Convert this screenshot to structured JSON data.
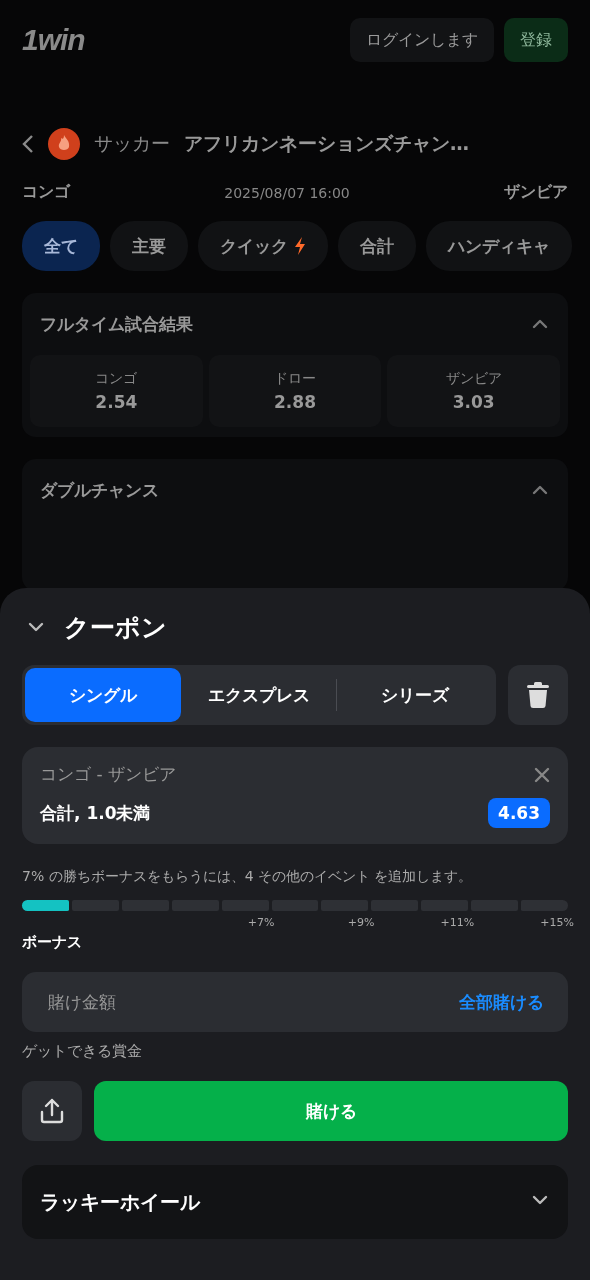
{
  "header": {
    "logo": "1win",
    "login": "ログインします",
    "register": "登録"
  },
  "breadcrumb": {
    "sport": "サッカー",
    "league": "アフリカンネーションズチャン…"
  },
  "match": {
    "home": "コンゴ",
    "datetime": "2025/08/07 16:00",
    "away": "ザンビア"
  },
  "filters": [
    {
      "label": "全て",
      "selected": true
    },
    {
      "label": "主要",
      "selected": false
    },
    {
      "label": "クイック",
      "selected": false,
      "hot": true
    },
    {
      "label": "合計",
      "selected": false
    },
    {
      "label": "ハンディキャ",
      "selected": false
    }
  ],
  "markets": [
    {
      "title": "フルタイム試合結果",
      "expanded": true,
      "outcomes": [
        {
          "name": "コンゴ",
          "odds": "2.54"
        },
        {
          "name": "ドロー",
          "odds": "2.88"
        },
        {
          "name": "ザンビア",
          "odds": "3.03"
        }
      ]
    },
    {
      "title": "ダブルチャンス",
      "expanded": true
    }
  ],
  "coupon": {
    "title": "クーポン",
    "tabs": [
      {
        "label": "シングル",
        "selected": true
      },
      {
        "label": "エクスプレス",
        "selected": false
      },
      {
        "label": "シリーズ",
        "selected": false
      }
    ],
    "bet": {
      "event": "コンゴ - ザンビア",
      "selection": "合計, 1.0未満",
      "odds": "4.63"
    },
    "bonus_hint": "7% の勝ちボーナスをもらうには、4 その他のイベント を追加します。",
    "segments": [
      {
        "filled": true
      },
      {
        "filled": false
      },
      {
        "filled": false
      },
      {
        "filled": false
      },
      {
        "filled": false,
        "label": "+7%"
      },
      {
        "filled": false
      },
      {
        "filled": false,
        "label": "+9%"
      },
      {
        "filled": false
      },
      {
        "filled": false,
        "label": "+11%"
      },
      {
        "filled": false
      },
      {
        "filled": false,
        "label": "+15%"
      }
    ],
    "bonus_label": "ボーナス",
    "stake": {
      "placeholder": "賭け金額",
      "max": "全部賭ける"
    },
    "winnings_label": "ゲットできる賞金",
    "place_bet": "賭ける",
    "lucky_wheel": {
      "title": "ラッキーホイール",
      "expanded": false
    }
  }
}
